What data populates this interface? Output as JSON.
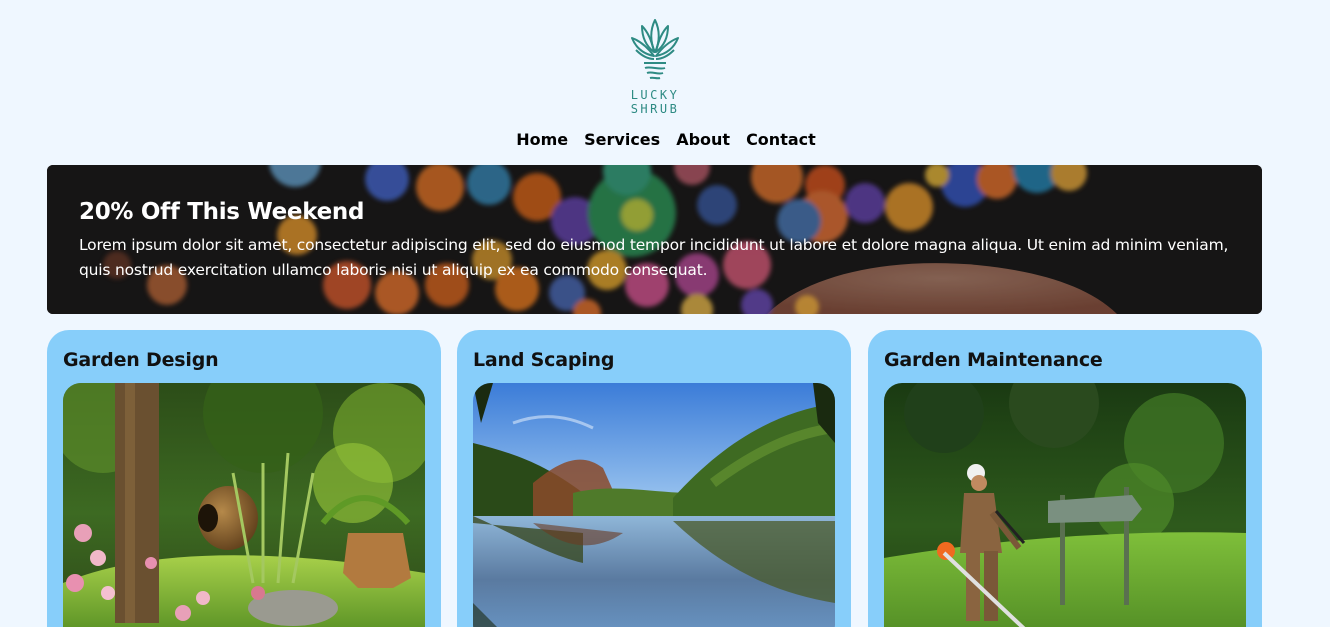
{
  "brand": {
    "line1": "LUCKY",
    "line2": "SHRUB",
    "accent": "#2e8b84"
  },
  "nav": {
    "items": [
      "Home",
      "Services",
      "About",
      "Contact"
    ]
  },
  "hero": {
    "title": "20% Off This Weekend",
    "text": "Lorem ipsum dolor sit amet, consectetur adipiscing elit, sed do eiusmod tempor incididunt ut labore et dolore magna aliqua. Ut enim ad minim veniam, quis nostrud exercitation ullamco laboris nisi ut aliquip ex ea commodo consequat."
  },
  "cards": [
    {
      "title": "Garden Design"
    },
    {
      "title": "Land Scaping"
    },
    {
      "title": "Garden Maintenance"
    }
  ],
  "colors": {
    "background": "#eff7ff",
    "card": "#87cefa",
    "hero": "#1c1a1a"
  }
}
